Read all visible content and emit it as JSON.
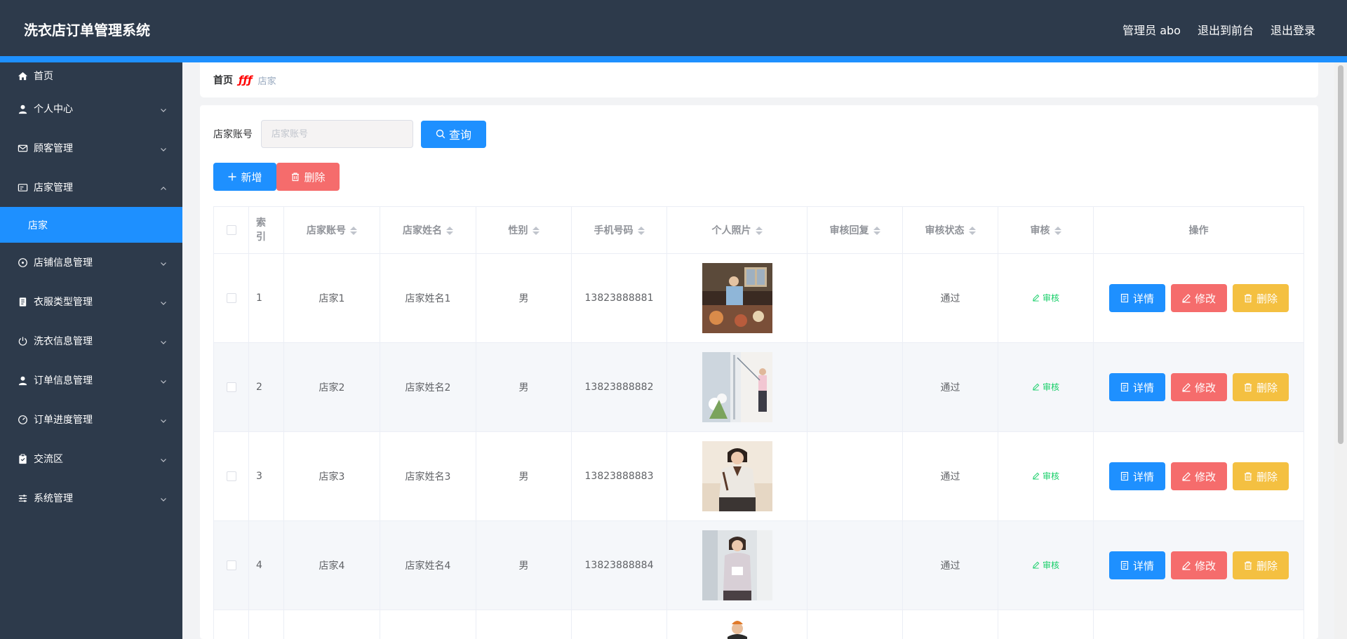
{
  "app": {
    "title": "洗衣店订单管理系统"
  },
  "header": {
    "user_label": "管理员 abo",
    "to_front": "退出到前台",
    "logout": "退出登录"
  },
  "sidebar": {
    "items": [
      {
        "label": "首页",
        "icon": "home-icon"
      },
      {
        "label": "个人中心",
        "icon": "user-icon"
      },
      {
        "label": "顾客管理",
        "icon": "mail-icon"
      },
      {
        "label": "店家管理",
        "icon": "postcard-icon",
        "expanded": true,
        "children": [
          {
            "label": "店家"
          }
        ]
      },
      {
        "label": "店铺信息管理",
        "icon": "compass-icon"
      },
      {
        "label": "衣服类型管理",
        "icon": "notebook-icon"
      },
      {
        "label": "洗衣信息管理",
        "icon": "power-icon"
      },
      {
        "label": "订单信息管理",
        "icon": "user-icon"
      },
      {
        "label": "订单进度管理",
        "icon": "gauge-icon"
      },
      {
        "label": "交流区",
        "icon": "clipboard-icon"
      },
      {
        "label": "系统管理",
        "icon": "sliders-icon"
      }
    ]
  },
  "breadcrumb": {
    "home": "首页",
    "current": "店家"
  },
  "search": {
    "label": "店家账号",
    "placeholder": "店家账号",
    "query_button": "查询"
  },
  "actions": {
    "add": "新增",
    "delete": "删除"
  },
  "table": {
    "headers": {
      "index": "索引",
      "account": "店家账号",
      "name": "店家姓名",
      "gender": "性别",
      "phone": "手机号码",
      "photo": "个人照片",
      "reply": "审核回复",
      "status": "审核状态",
      "audit": "审核",
      "ops": "操作"
    },
    "audit_link": "审核",
    "op_detail": "详情",
    "op_edit": "修改",
    "op_delete": "删除",
    "rows": [
      {
        "index": "1",
        "account": "店家1",
        "name": "店家姓名1",
        "gender": "男",
        "phone": "13823888881",
        "reply": "",
        "status": "通过"
      },
      {
        "index": "2",
        "account": "店家2",
        "name": "店家姓名2",
        "gender": "男",
        "phone": "13823888882",
        "reply": "",
        "status": "通过"
      },
      {
        "index": "3",
        "account": "店家3",
        "name": "店家姓名3",
        "gender": "男",
        "phone": "13823888883",
        "reply": "",
        "status": "通过"
      },
      {
        "index": "4",
        "account": "店家4",
        "name": "店家姓名4",
        "gender": "男",
        "phone": "13823888884",
        "reply": "",
        "status": "通过"
      }
    ]
  },
  "colors": {
    "primary": "#1e90ff",
    "danger": "#f56c6c",
    "warning": "#f4c041",
    "success": "#13ce66",
    "header_bg": "#2d3a4b"
  }
}
